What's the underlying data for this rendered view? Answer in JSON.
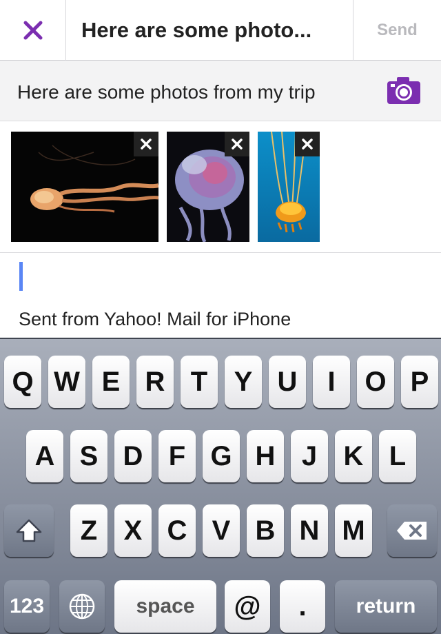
{
  "header": {
    "title": "Here are some photo...",
    "send_label": "Send"
  },
  "subject": {
    "text": "Here are some photos from my trip"
  },
  "attachments": [
    {
      "name": "jellyfish-photo-1",
      "subject": "orange jellyfish on black background"
    },
    {
      "name": "jellyfish-photo-2",
      "subject": "purple jellyfish"
    },
    {
      "name": "jellyfish-photo-3",
      "subject": "orange jellyfish on blue water"
    }
  ],
  "body": {
    "signature": "Sent from Yahoo! Mail for iPhone"
  },
  "keyboard": {
    "row1": [
      "Q",
      "W",
      "E",
      "R",
      "T",
      "Y",
      "U",
      "I",
      "O",
      "P"
    ],
    "row2": [
      "A",
      "S",
      "D",
      "F",
      "G",
      "H",
      "J",
      "K",
      "L"
    ],
    "row3": [
      "Z",
      "X",
      "C",
      "V",
      "B",
      "N",
      "M"
    ],
    "numbers_label": "123",
    "space_label": "space",
    "at_label": "@",
    "dot_label": ".",
    "return_label": "return"
  },
  "colors": {
    "accent": "#7b2eb0",
    "cursor": "#5a86f5",
    "send_disabled": "#b9b9bd"
  }
}
